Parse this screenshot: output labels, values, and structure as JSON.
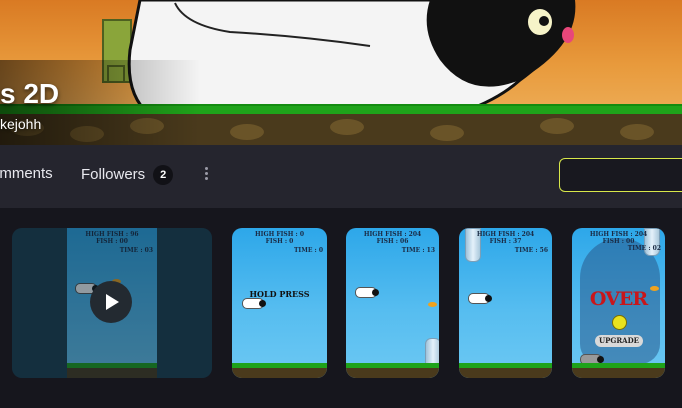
{
  "banner": {
    "title": "s 2D",
    "author": "kejohh"
  },
  "tabs": {
    "comments": "omments",
    "followers": "Followers",
    "followers_count": "2"
  },
  "search": {
    "value": ""
  },
  "thumbnails": [
    {
      "kind": "video",
      "hud1": "HIGH FISH : 96",
      "hud2": "FISH : 00",
      "time": "TIME : 03"
    },
    {
      "hud1": "HIGH FISH : 0",
      "hud2": "FISH : 0",
      "time": "TIME : 0",
      "label": "HOLD PRESS"
    },
    {
      "hud1": "HIGH FISH : 204",
      "hud2": "FISH : 06",
      "time": "TIME : 13"
    },
    {
      "hud1": "HIGH FISH : 204",
      "hud2": "FISH : 37",
      "time": "TIME : 56"
    },
    {
      "hud1": "HIGH FISH : 204",
      "hud2": "FISH : 00",
      "time": "TIME : 02",
      "over": "OVER",
      "upgrade": "UPGRADE"
    }
  ],
  "icons": {
    "play": "play-icon",
    "more": "more-vertical-icon"
  },
  "colors": {
    "accent": "#d8e84a",
    "grass": "#1fa31a",
    "sky": "#2da7e9",
    "over": "#c8161b"
  }
}
